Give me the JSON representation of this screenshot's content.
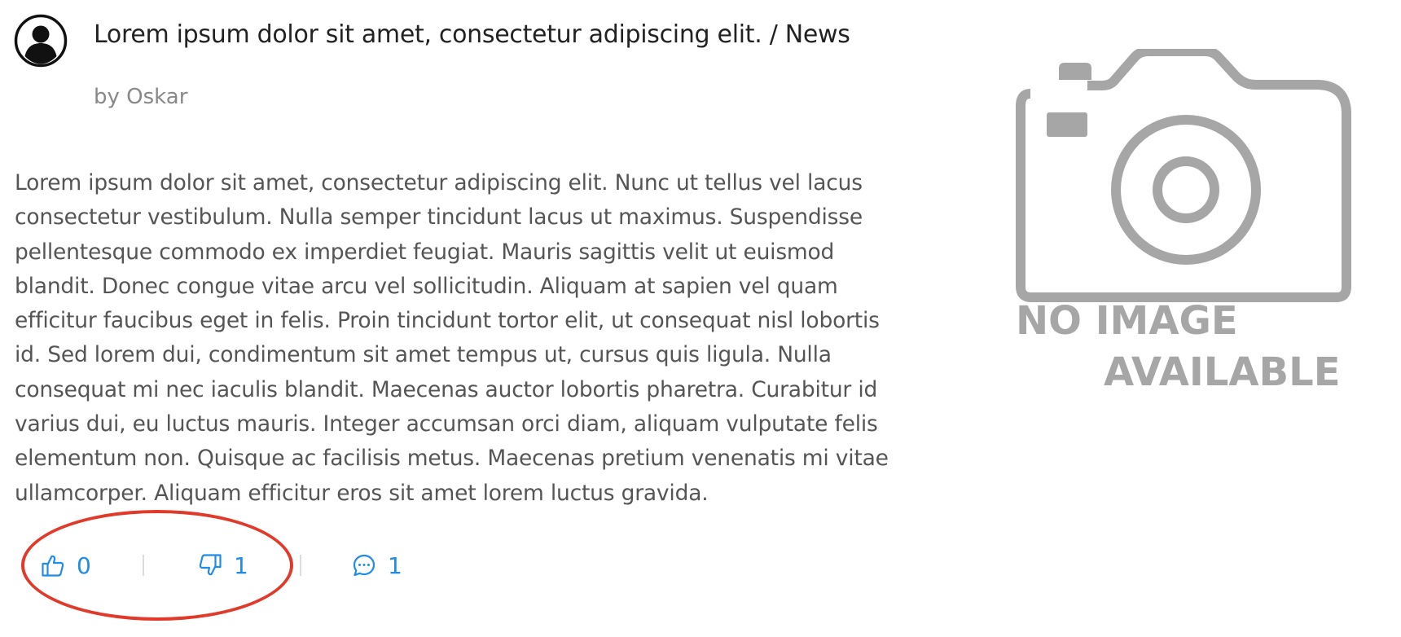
{
  "post": {
    "title": "Lorem ipsum dolor sit amet, consectetur adipiscing elit. / News",
    "author": "by Oskar",
    "body": "Lorem ipsum dolor sit amet, consectetur adipiscing elit. Nunc ut tellus vel lacus consectetur vestibulum. Nulla semper tincidunt lacus ut maximus. Suspendisse pellentesque commodo ex imperdiet feugiat. Mauris sagittis velit ut euismod blandit. Donec congue vitae arcu vel sollicitudin. Aliquam at sapien vel quam efficitur faucibus eget in felis. Proin tincidunt tortor elit, ut consequat nisl lobortis id. Sed lorem dui, condimentum sit amet tempus ut, cursus quis ligula. Nulla consequat mi nec iaculis blandit. Maecenas auctor lobortis pharetra. Curabitur id varius dui, eu luctus mauris. Integer accumsan orci diam, aliquam vulputate felis elementum non. Quisque ac facilisis metus. Maecenas pretium venenatis mi vitae ullamcorper. Aliquam efficitur eros sit amet lorem luctus gravida."
  },
  "actions": {
    "likes": "0",
    "dislikes": "1",
    "comments": "1"
  },
  "image_placeholder": {
    "line1": "NO IMAGE",
    "line2": "AVAILABLE"
  },
  "colors": {
    "accent": "#1f8ceb",
    "highlight": "#e23a2a",
    "placeholder_gray": "#a6a6a6"
  },
  "icons": {
    "avatar": "user-circle-icon",
    "like": "thumbs-up-icon",
    "dislike": "thumbs-down-icon",
    "comments": "comment-bubble-icon",
    "image": "camera-icon"
  }
}
